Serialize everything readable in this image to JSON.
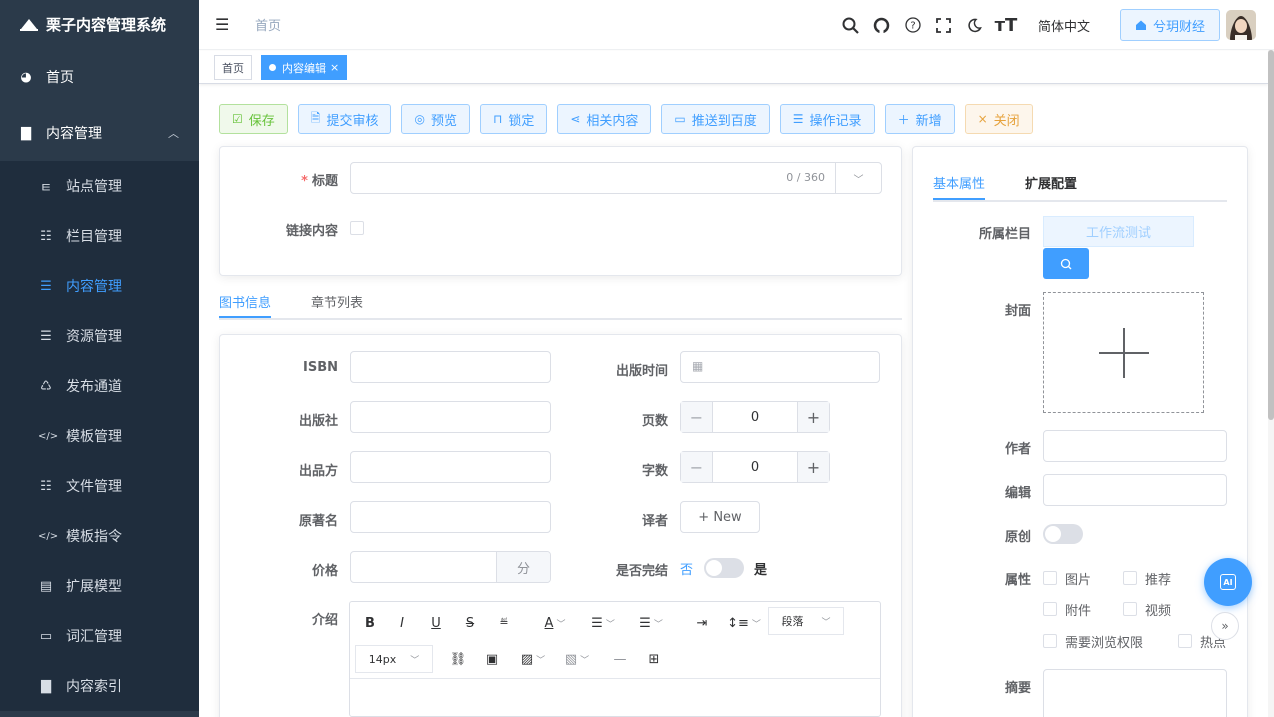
{
  "app": {
    "title": "栗子内容管理系统"
  },
  "sidebar": {
    "items": [
      {
        "label": "首页",
        "icon": "dashboard-icon"
      },
      {
        "label": "内容管理",
        "icon": "document-icon"
      },
      {
        "label": "站点管理",
        "icon": "site-icon"
      },
      {
        "label": "栏目管理",
        "icon": "tree-icon"
      },
      {
        "label": "内容管理",
        "icon": "list-icon"
      },
      {
        "label": "资源管理",
        "icon": "list-icon"
      },
      {
        "label": "发布通道",
        "icon": "publish-icon"
      },
      {
        "label": "模板管理",
        "icon": "code-icon"
      },
      {
        "label": "文件管理",
        "icon": "tree-icon"
      },
      {
        "label": "模板指令",
        "icon": "code-icon"
      },
      {
        "label": "扩展模型",
        "icon": "model-icon"
      },
      {
        "label": "词汇管理",
        "icon": "vocab-icon"
      },
      {
        "label": "内容索引",
        "icon": "document-icon"
      }
    ]
  },
  "header": {
    "breadcrumb": "首页",
    "language": "简体中文",
    "site": "兮玥财经"
  },
  "tags": {
    "home": "首页",
    "current": "内容编辑"
  },
  "toolbar": {
    "save": "保存",
    "submit": "提交审核",
    "preview": "预览",
    "lock": "锁定",
    "related": "相关内容",
    "baidu": "推送到百度",
    "log": "操作记录",
    "add": "新增",
    "close": "关闭"
  },
  "form": {
    "title_label": "标题",
    "title_counter": "0 / 360",
    "link_label": "链接内容"
  },
  "book_tabs": {
    "info": "图书信息",
    "chapters": "章节列表"
  },
  "book": {
    "isbn": "ISBN",
    "publish_time": "出版时间",
    "publisher": "出版社",
    "pages": "页数",
    "pages_value": "0",
    "producer": "出品方",
    "words": "字数",
    "words_value": "0",
    "original_name": "原著名",
    "translator": "译者",
    "new_button": "+ New",
    "price": "价格",
    "price_unit": "分",
    "finished": "是否完结",
    "finished_no": "否",
    "finished_yes": "是",
    "intro": "介绍",
    "font_size": "14px",
    "paragraph": "段落"
  },
  "right_tabs": {
    "basic": "基本属性",
    "ext": "扩展配置"
  },
  "right": {
    "catalog_label": "所属栏目",
    "catalog_value": "工作流测试",
    "cover": "封面",
    "author": "作者",
    "editor": "编辑",
    "original": "原创",
    "attrs": "属性",
    "attr_image": "图片",
    "attr_recommend": "推荐",
    "attr_attachment": "附件",
    "attr_video": "视频",
    "attr_permission": "需要浏览权限",
    "attr_hot": "热点",
    "summary": "摘要"
  },
  "fab": {
    "ai": "AI"
  },
  "colors": {
    "primary": "#409eff",
    "sidebar": "#2b3a4a",
    "success": "#67c23a",
    "warning": "#e6a23c"
  }
}
